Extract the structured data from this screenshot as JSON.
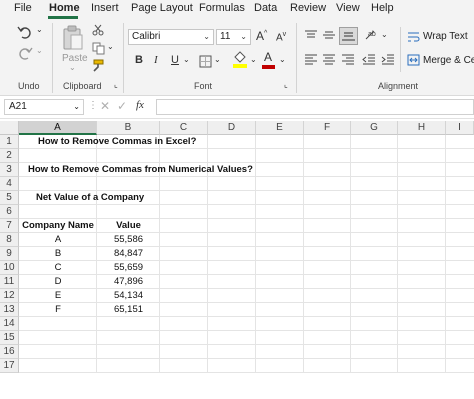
{
  "menu": {
    "tabs": [
      "File",
      "Home",
      "Insert",
      "Page Layout",
      "Formulas",
      "Data",
      "Review",
      "View",
      "Help"
    ],
    "active": "Home"
  },
  "ribbon": {
    "undo_label": "Undo",
    "clipboard_label": "Clipboard",
    "paste_label": "Paste",
    "font_label": "Font",
    "alignment_label": "Alignment",
    "font_name": "Calibri",
    "font_size": "11",
    "wrap_text": "Wrap Text",
    "merge_center": "Merge & Cen",
    "bold": "B",
    "italic": "I",
    "underline": "U",
    "grow_font": "A",
    "shrink_font": "A",
    "font_color": "A"
  },
  "formula_bar": {
    "name_box": "A21",
    "fx": "fx",
    "value": ""
  },
  "sheet": {
    "columns": [
      "A",
      "B",
      "C",
      "D",
      "E",
      "F",
      "G",
      "H",
      "I"
    ],
    "selected_column": "A",
    "rows": [
      "1",
      "2",
      "3",
      "4",
      "5",
      "6",
      "7",
      "8",
      "9",
      "10",
      "11",
      "12",
      "13",
      "14",
      "15",
      "16",
      "17"
    ],
    "title1": "How to Remove Commas in Excel?",
    "title2": "How to Remove Commas from Numerical Values?",
    "subtitle": "Net Value of a Company",
    "table_header": {
      "company": "Company Name",
      "value": "Value"
    },
    "table_rows": [
      {
        "company": "A",
        "value": "55,586"
      },
      {
        "company": "B",
        "value": "84,847"
      },
      {
        "company": "C",
        "value": "55,659"
      },
      {
        "company": "D",
        "value": "47,896"
      },
      {
        "company": "E",
        "value": "54,134"
      },
      {
        "company": "F",
        "value": "65,151"
      }
    ]
  },
  "colors": {
    "accent": "#217346",
    "font_color_bar": "#c00000",
    "highlight_bar": "#ffff00"
  }
}
